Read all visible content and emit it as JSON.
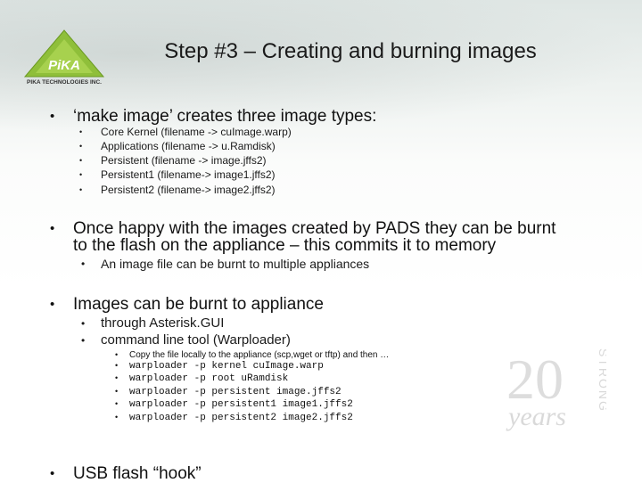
{
  "slide": {
    "title": "Step #3 – Creating and burning images",
    "logo_text": "PIKA TECHNOLOGIES INC.",
    "logo_mark": "PiKA",
    "watermark_number": "20",
    "watermark_word": "years",
    "watermark_vertical": "STRONG",
    "bullet_char": "•",
    "section1": {
      "heading": "‘make image’ creates three image types:",
      "items": [
        "Core Kernel  (filename -> cuImage.warp)",
        "Applications   (filename -> u.Ramdisk)",
        "Persistent  (filename -> image.jffs2)",
        "Persistent1 (filename-> image1.jffs2)",
        "Persistent2 (filename-> image2.jffs2)"
      ]
    },
    "section2": {
      "heading_line1": "Once happy with the images created by PADS they can be burnt",
      "heading_line2": "to the flash on the appliance – this commits it to memory",
      "items": [
        "An image file can be burnt to multiple appliances"
      ]
    },
    "section3": {
      "heading": "Images can be burnt to appliance",
      "items": [
        "through Asterisk.GUI",
        "command line tool (Warploader)"
      ],
      "commands_intro": "Copy the file locally to the appliance (scp,wget or tftp) and then …",
      "commands": [
        "warploader -p kernel cuImage.warp",
        "warploader -p root uRamdisk",
        "warploader -p persistent image.jffs2",
        "warploader -p persistent1 image1.jffs2",
        "warploader -p persistent2 image2.jffs2"
      ]
    },
    "section4": {
      "heading": "USB flash “hook”"
    }
  }
}
